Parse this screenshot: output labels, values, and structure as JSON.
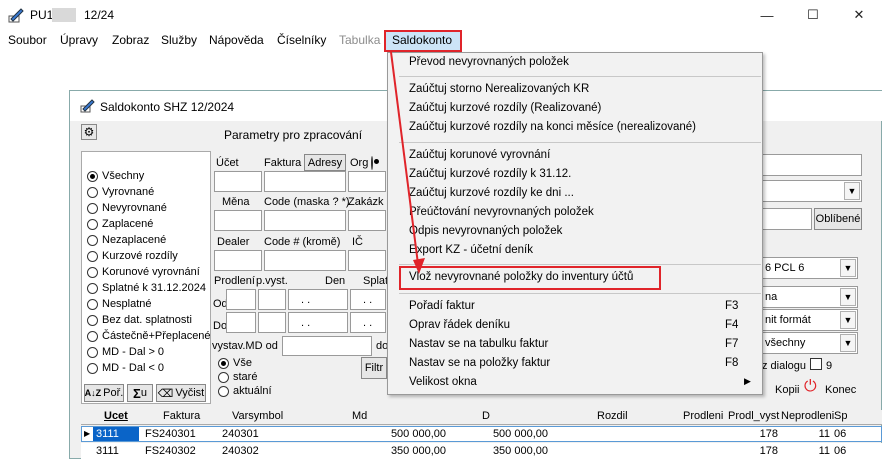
{
  "window": {
    "title_prefix": "PU1",
    "title_suffix": "12/24",
    "minimize": "—",
    "maximize": "☐",
    "close": "✕"
  },
  "menubar": [
    {
      "label": "Soubor"
    },
    {
      "label": "Úpravy"
    },
    {
      "label": "Zobraz"
    },
    {
      "label": "Služby"
    },
    {
      "label": "Nápověda"
    },
    {
      "label": "Číselníky"
    },
    {
      "label": "Tabulka"
    },
    {
      "label": "Saldokonto"
    }
  ],
  "dropdown": {
    "items": [
      {
        "label": "Převod nevyrovnaných položek"
      },
      {
        "label": "Zaúčtuj storno Nerealizovaných KR"
      },
      {
        "label": "Zaúčtuj kurzové rozdíly (Realizované)"
      },
      {
        "label": "Zaúčtuj kurzové rozdíly na konci měsíce (nerealizované)"
      },
      {
        "label": "Zaúčtuj korunové vyrovnání"
      },
      {
        "label": "Zaúčtuj kurzové rozdíly k 31.12."
      },
      {
        "label": "Zaúčtuj kurzové rozdíly ke dni ..."
      },
      {
        "label": "Přeúčtování nevyrovnaných položek"
      },
      {
        "label": "Odpis nevyrovnaných položek"
      },
      {
        "label": "Export KZ - účetní deník"
      },
      {
        "label": "Vlož nevyrovnané položky do inventury účtů"
      },
      {
        "label": "Pořadí faktur",
        "shortcut": "F3"
      },
      {
        "label": "Oprav řádek deníku",
        "shortcut": "F4"
      },
      {
        "label": "Nastav se na tabulku faktur",
        "shortcut": "F7"
      },
      {
        "label": "Nastav se na položky faktur",
        "shortcut": "F8"
      },
      {
        "label": "Velikost okna"
      }
    ]
  },
  "child": {
    "title": "Saldokonto  SHZ  12/2024",
    "param_title": "Parametry pro  zpracování",
    "radios": [
      {
        "label": "Všechny",
        "selected": true
      },
      {
        "label": "Vyrovnané"
      },
      {
        "label": "Nevyrovnané"
      },
      {
        "label": "Zaplacené"
      },
      {
        "label": "Nezaplacené"
      },
      {
        "label": "Kurzové rozdíly"
      },
      {
        "label": "Korunové vyrovnání"
      },
      {
        "label": "Splatné k 31.12.2024"
      },
      {
        "label": "Nesplatné"
      },
      {
        "label": "Bez dat. splatnosti"
      },
      {
        "label": "Částečně+Přeplacené"
      },
      {
        "label": "MD - Dal > 0"
      },
      {
        "label": "MD - Dal < 0"
      }
    ],
    "labels": {
      "ucet": "Účet",
      "faktura": "Faktura",
      "adresy": "Adresy",
      "org": "Org",
      "mena": "Měna",
      "code_maska": "Code (maska ? *)",
      "zakazka": "Zakázk",
      "dealer": "Dealer",
      "code_krome": "Code # (kromě)",
      "ic": "IČ",
      "prodleni": "Prodlení",
      "pvyst": "p.vyst.",
      "den": "Den",
      "splat": "Splat",
      "od": "Od",
      "do": "Do",
      "vystav_md_od": "vystav.MD od",
      "do2": "do",
      "vse": "Vše",
      "stare": "staré",
      "aktualni": "aktuální",
      "filtr": "Filtr",
      "date_placeholder": ". .",
      "por": "Poř.",
      "sum_u": "u",
      "vycist": "Vyčist",
      "oblibene": "Oblíbené",
      "pcl": "6 PCL 6",
      "na": "na",
      "nit_format": "nit formát",
      "vsechny": "všechny",
      "z_dialogu": "z dialogu",
      "z_dialogu_val": "9",
      "kopii": "Kopii",
      "konec": "Konec"
    }
  },
  "table": {
    "columns": [
      "Ucet",
      "Faktura",
      "Varsymbol",
      "Md",
      "D",
      "Rozdil",
      "Prodleni",
      "Prodl_vyst",
      "Neprodleni",
      "Sp"
    ],
    "rows": [
      [
        "3111",
        "FS240301",
        "240301",
        "500 000,00",
        "500 000,00",
        "",
        "",
        "178",
        "11",
        "06"
      ],
      [
        "3111",
        "FS240302",
        "240302",
        "350 000,00",
        "350 000,00",
        "",
        "",
        "178",
        "11",
        "06"
      ]
    ]
  },
  "colors": {
    "highlight_border": "#e0242a",
    "selection": "#0a64c8"
  }
}
